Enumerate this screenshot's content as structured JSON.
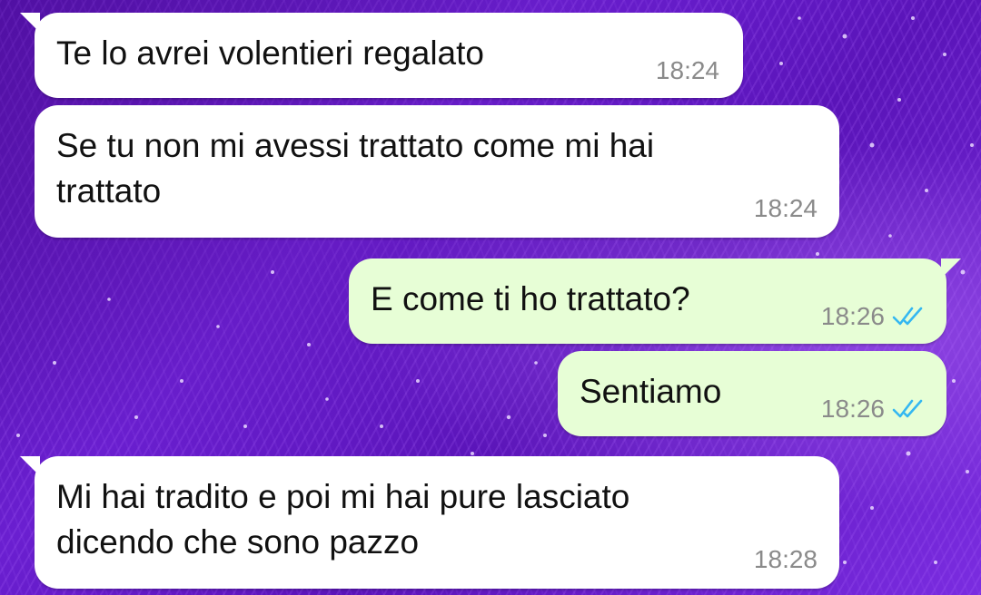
{
  "messages": [
    {
      "direction": "incoming",
      "text": "Te lo avrei volentieri regalato",
      "time": "18:24"
    },
    {
      "direction": "incoming",
      "text": "Se tu non mi avessi trattato come mi hai\ntrattato",
      "time": "18:24"
    },
    {
      "direction": "outgoing",
      "text": "E come ti ho trattato?",
      "time": "18:26",
      "status": "read-double-check-icon"
    },
    {
      "direction": "outgoing",
      "text": "Sentiamo",
      "time": "18:26",
      "status": "read-double-check-icon"
    },
    {
      "direction": "incoming",
      "text": "Mi hai tradito e poi mi hai pure lasciato\ndicendo che sono pazzo",
      "time": "18:28"
    }
  ],
  "colors": {
    "incoming_bubble": "#ffffff",
    "outgoing_bubble": "#e7fed6",
    "read_check": "#34b7f1",
    "background": "#5a14b8"
  }
}
